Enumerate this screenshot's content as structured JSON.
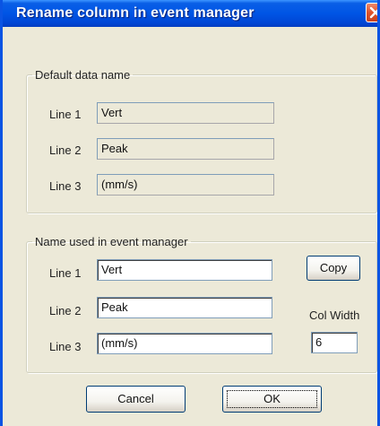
{
  "window": {
    "title": "Rename  column in event manager"
  },
  "default_group": {
    "legend": "Default data name",
    "rows": [
      {
        "label": "Line 1",
        "value": "Vert"
      },
      {
        "label": "Line 2",
        "value": "Peak"
      },
      {
        "label": "Line 3",
        "value": "(mm/s)"
      }
    ]
  },
  "event_group": {
    "legend": "Name used in event manager",
    "rows": [
      {
        "label": "Line 1",
        "value": "Vert"
      },
      {
        "label": "Line 2",
        "value": "Peak"
      },
      {
        "label": "Line 3",
        "value": "(mm/s)"
      }
    ],
    "copy_label": "Copy",
    "col_width_label": "Col Width",
    "col_width_value": "6"
  },
  "buttons": {
    "cancel_label": "Cancel",
    "ok_label": "OK"
  },
  "colors": {
    "title_bar": "#0055e5",
    "window_bg": "#ece9d8",
    "close_button": "#e0532b"
  }
}
